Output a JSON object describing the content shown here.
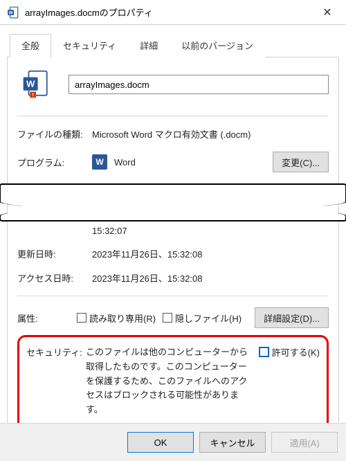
{
  "titlebar": {
    "title": "arrayImages.docmのプロパティ"
  },
  "tabs": {
    "general": "全般",
    "security": "セキュリティ",
    "details": "詳細",
    "previous": "以前のバージョン"
  },
  "file": {
    "name": "arrayImages.docm"
  },
  "filetype": {
    "label": "ファイルの種類:",
    "value": "Microsoft Word マクロ有効文書 (.docm)"
  },
  "program": {
    "label": "プログラム:",
    "value": "Word",
    "change_btn": "変更(C)..."
  },
  "created_partial": {
    "time_fragment": "15:32:07"
  },
  "modified": {
    "label": "更新日時:",
    "value": "2023年11月26日、15:32:08"
  },
  "accessed": {
    "label": "アクセス日時:",
    "value": "2023年11月26日、15:32:08"
  },
  "attributes": {
    "label": "属性:",
    "readonly": "読み取り専用(R)",
    "hidden": "隠しファイル(H)",
    "advanced_btn": "詳細設定(D)..."
  },
  "security": {
    "label": "セキュリティ:",
    "message": "このファイルは他のコンピューターから取得したものです。このコンピューターを保護するため、このファイルへのアクセスはブロックされる可能性があります。",
    "allow": "許可する(K)"
  },
  "footer": {
    "ok": "OK",
    "cancel": "キャンセル",
    "apply": "適用(A)"
  }
}
